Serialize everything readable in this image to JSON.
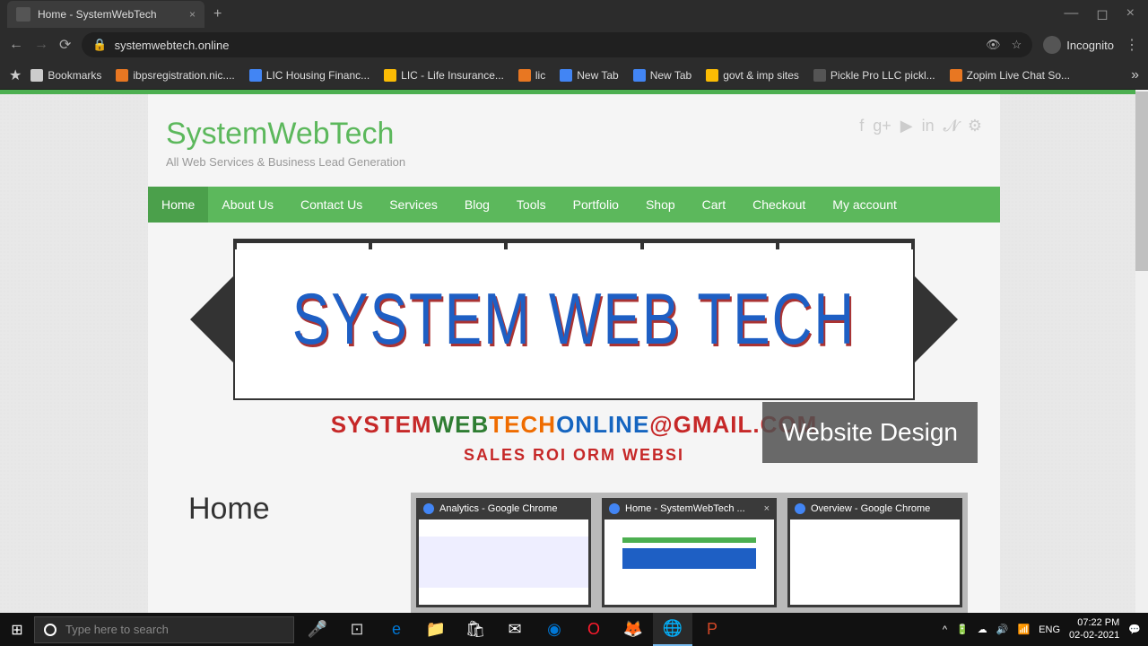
{
  "browser": {
    "tab_title": "Home - SystemWebTech",
    "url": "systemwebtech.online",
    "incognito_label": "Incognito"
  },
  "bookmarks": [
    {
      "label": "Bookmarks",
      "color": "#ccc"
    },
    {
      "label": "ibpsregistration.nic....",
      "color": "#e87722"
    },
    {
      "label": "LIC Housing Financ...",
      "color": "#4285f4"
    },
    {
      "label": "LIC - Life Insurance...",
      "color": "#fbbc04"
    },
    {
      "label": "lic",
      "color": "#e87722"
    },
    {
      "label": "New Tab",
      "color": "#4285f4"
    },
    {
      "label": "New Tab",
      "color": "#4285f4"
    },
    {
      "label": "govt & imp sites",
      "color": "#fbbc04"
    },
    {
      "label": "Pickle Pro LLC pickl...",
      "color": "#555"
    },
    {
      "label": "Zopim Live Chat So...",
      "color": "#e87722"
    }
  ],
  "site": {
    "title": "SystemWebTech",
    "tagline": "All Web Services & Business Lead Generation",
    "logo_text": "SYSTEM WEB TECH",
    "email_parts": [
      "SYSTEM",
      "WEB",
      "TECH",
      "ONLINE",
      "@GMAIL.COM"
    ],
    "design_badge": "Website Design",
    "tags": "SALES  ROI  ORM  WEBSI",
    "page_heading": "Home"
  },
  "nav": [
    "Home",
    "About Us",
    "Contact Us",
    "Services",
    "Blog",
    "Tools",
    "Portfolio",
    "Shop",
    "Cart",
    "Checkout",
    "My account"
  ],
  "social": [
    "f",
    "g+",
    "▶",
    "in",
    "𝓝",
    "⚙"
  ],
  "task_switcher": [
    {
      "title": "Analytics - Google Chrome"
    },
    {
      "title": "Home - SystemWebTech ...",
      "close": true
    },
    {
      "title": "Overview - Google Chrome"
    }
  ],
  "taskbar": {
    "search_placeholder": "Type here to search",
    "time": "07:22 PM",
    "date": "02-02-2021"
  }
}
